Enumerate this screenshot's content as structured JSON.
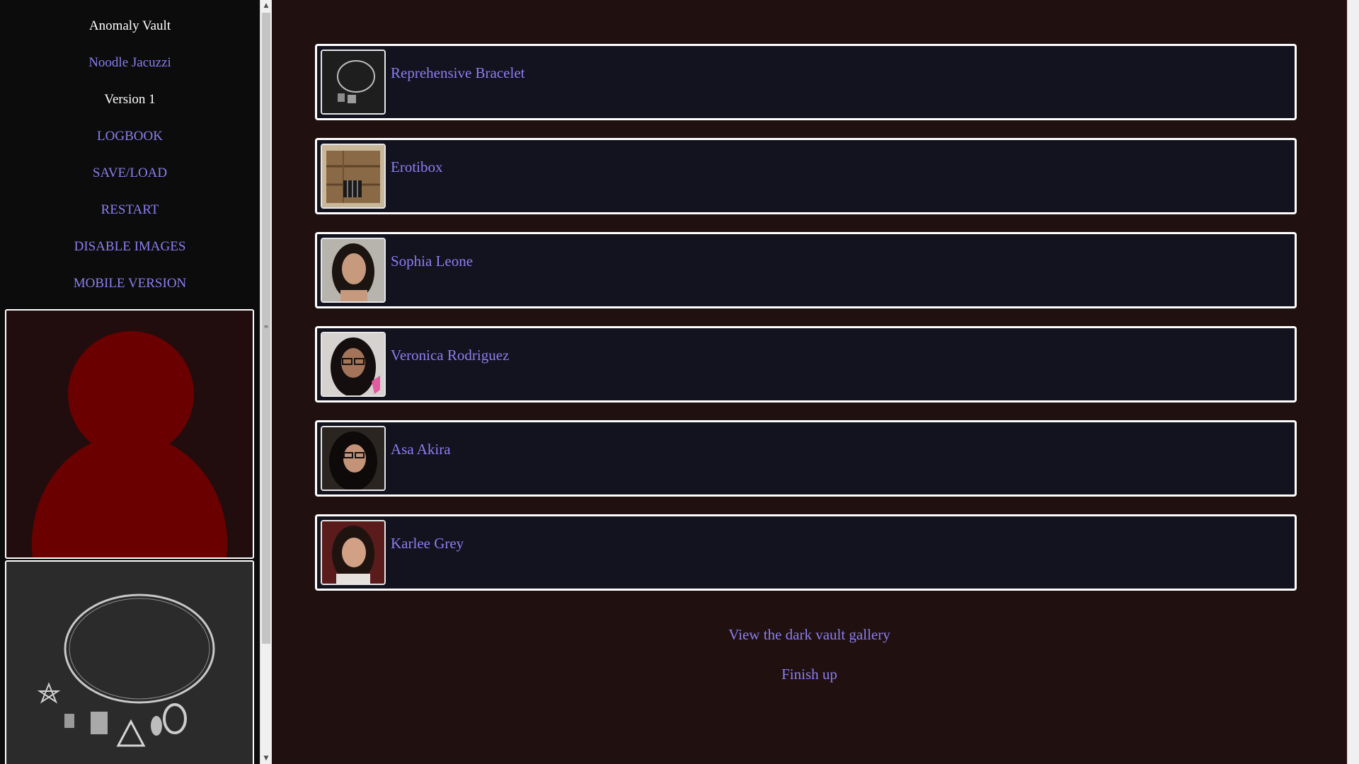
{
  "sidebar": {
    "title": "Anomaly Vault",
    "location": "Noodle Jacuzzi",
    "version": "Version 1",
    "menu": {
      "logbook": "LOGBOOK",
      "saveload": "SAVE/LOAD",
      "restart": "RESTART",
      "disable_images": "DISABLE IMAGES",
      "mobile_version": "MOBILE VERSION"
    },
    "avatar_color": "#6b0000"
  },
  "main": {
    "items": [
      {
        "label": "Reprehensive Bracelet"
      },
      {
        "label": "Erotibox"
      },
      {
        "label": "Sophia Leone"
      },
      {
        "label": "Veronica Rodriguez"
      },
      {
        "label": "Asa Akira"
      },
      {
        "label": "Karlee Grey"
      }
    ],
    "links": {
      "gallery": "View the dark vault gallery",
      "finish": "Finish up"
    }
  },
  "colors": {
    "link": "#8a7ff0",
    "card_bg": "#13121f",
    "page_bg": "#201010",
    "sidebar_bg": "#0c0c0c"
  }
}
